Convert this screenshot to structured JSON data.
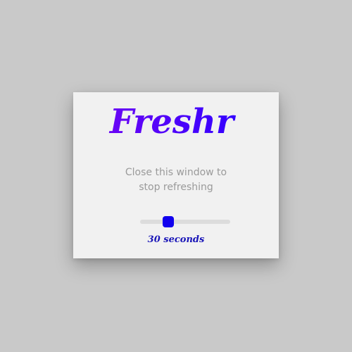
{
  "app": {
    "logo_text": "Freshr",
    "logo_colors": [
      "#6a05f5",
      "#3300ff"
    ]
  },
  "message": {
    "line1": "Close this window to",
    "line2": "stop refreshing"
  },
  "refresh": {
    "slider_level": 0.31,
    "accent_color": "#1100ee",
    "interval_label": "30 seconds"
  }
}
